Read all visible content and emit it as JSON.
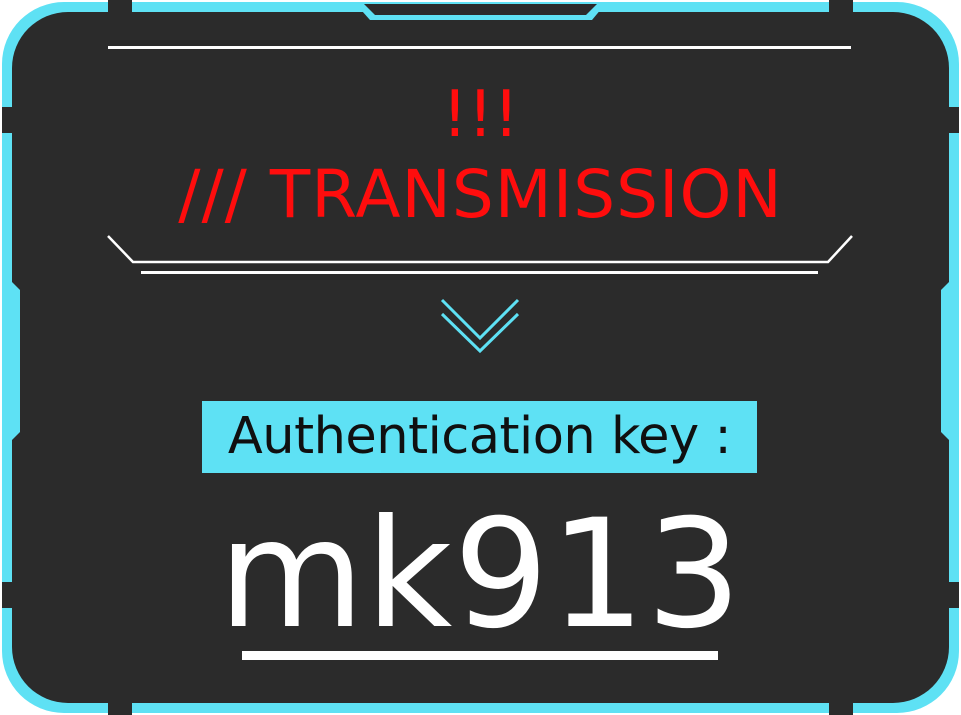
{
  "panel": {
    "alert": "!!!",
    "title": "/// TRANSMISSION",
    "key_label": "Authentication key :",
    "key_value": "mk913"
  },
  "colors": {
    "panel_background": "#2b2b2b",
    "frame_accent": "#5ee1f4",
    "alert_text": "#ff0d0d",
    "divider_lines": "#ffffff",
    "key_value_text": "#ffffff"
  },
  "icons": {
    "separator": "double-chevron-down-icon"
  }
}
